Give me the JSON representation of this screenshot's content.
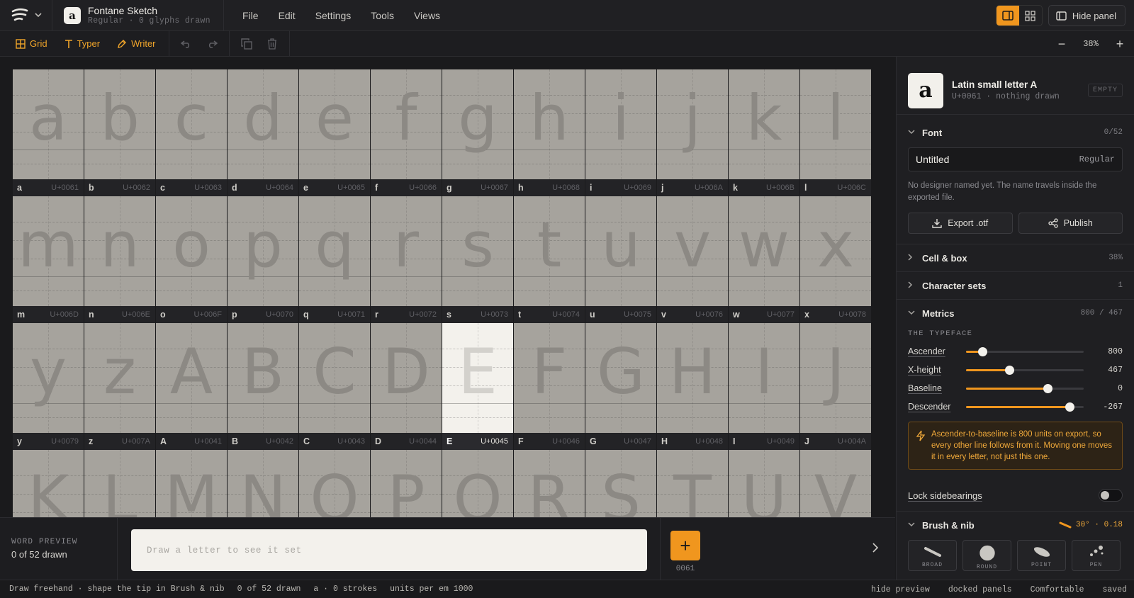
{
  "app": {
    "name": "Fontane Sketch",
    "doc_icon_glyph": "a",
    "subtitle": "Regular · 0 glyphs drawn"
  },
  "menu": [
    "File",
    "Edit",
    "Settings",
    "Tools",
    "Views"
  ],
  "top_right": {
    "hide_panel_label": "Hide panel"
  },
  "toolbar": {
    "grid": "Grid",
    "typer": "Typer",
    "writer": "Writer"
  },
  "zoom": {
    "value": "38%",
    "minus": "−",
    "plus": "+"
  },
  "glyphs": [
    {
      "char": "a",
      "code": "U+0061"
    },
    {
      "char": "b",
      "code": "U+0062"
    },
    {
      "char": "c",
      "code": "U+0063"
    },
    {
      "char": "d",
      "code": "U+0064"
    },
    {
      "char": "e",
      "code": "U+0065"
    },
    {
      "char": "f",
      "code": "U+0066"
    },
    {
      "char": "g",
      "code": "U+0067"
    },
    {
      "char": "h",
      "code": "U+0068"
    },
    {
      "char": "i",
      "code": "U+0069"
    },
    {
      "char": "j",
      "code": "U+006A"
    },
    {
      "char": "k",
      "code": "U+006B"
    },
    {
      "char": "l",
      "code": "U+006C"
    },
    {
      "char": "m",
      "code": "U+006D"
    },
    {
      "char": "n",
      "code": "U+006E"
    },
    {
      "char": "o",
      "code": "U+006F"
    },
    {
      "char": "p",
      "code": "U+0070"
    },
    {
      "char": "q",
      "code": "U+0071"
    },
    {
      "char": "r",
      "code": "U+0072"
    },
    {
      "char": "s",
      "code": "U+0073"
    },
    {
      "char": "t",
      "code": "U+0074"
    },
    {
      "char": "u",
      "code": "U+0075"
    },
    {
      "char": "v",
      "code": "U+0076"
    },
    {
      "char": "w",
      "code": "U+0077"
    },
    {
      "char": "x",
      "code": "U+0078"
    },
    {
      "char": "y",
      "code": "U+0079"
    },
    {
      "char": "z",
      "code": "U+007A"
    },
    {
      "char": "A",
      "code": "U+0041"
    },
    {
      "char": "B",
      "code": "U+0042"
    },
    {
      "char": "C",
      "code": "U+0043"
    },
    {
      "char": "D",
      "code": "U+0044"
    },
    {
      "char": "E",
      "code": "U+0045"
    },
    {
      "char": "F",
      "code": "U+0046"
    },
    {
      "char": "G",
      "code": "U+0047"
    },
    {
      "char": "H",
      "code": "U+0048"
    },
    {
      "char": "I",
      "code": "U+0049"
    },
    {
      "char": "J",
      "code": "U+004A"
    },
    {
      "char": "K",
      "code": ""
    },
    {
      "char": "L",
      "code": ""
    },
    {
      "char": "M",
      "code": ""
    },
    {
      "char": "N",
      "code": ""
    },
    {
      "char": "O",
      "code": ""
    },
    {
      "char": "P",
      "code": ""
    },
    {
      "char": "Q",
      "code": ""
    },
    {
      "char": "R",
      "code": ""
    },
    {
      "char": "S",
      "code": ""
    },
    {
      "char": "T",
      "code": ""
    },
    {
      "char": "U",
      "code": ""
    },
    {
      "char": "V",
      "code": ""
    }
  ],
  "selected_glyph": "E",
  "preview": {
    "title": "WORD PREVIEW",
    "count": "0 of 52 drawn",
    "placeholder": "Draw a letter to see it set",
    "add_label": "+",
    "code": "0061"
  },
  "panel": {
    "glyph": "a",
    "name": "Latin small letter A",
    "sub": "U+0061 · nothing drawn",
    "badge": "EMPTY",
    "font": {
      "title": "Font",
      "count": "0/52",
      "name": "Untitled",
      "style": "Regular",
      "note": "No designer named yet. The name travels inside the exported file.",
      "export_label": "Export .otf",
      "publish_label": "Publish"
    },
    "cell_box": {
      "title": "Cell & box",
      "value": "38%"
    },
    "charsets": {
      "title": "Character sets",
      "value": "1"
    },
    "metrics": {
      "title": "Metrics",
      "value": "800 / 467",
      "subhead": "THE TYPEFACE",
      "sliders": [
        {
          "label": "Ascender",
          "value": "800",
          "level": 0.14
        },
        {
          "label": "X-height",
          "value": "467",
          "level": 0.37
        },
        {
          "label": "Baseline",
          "value": "0",
          "level": 0.69
        },
        {
          "label": "Descender",
          "value": "-267",
          "level": 0.88
        }
      ],
      "warning": "Ascender-to-baseline is 800 units on export, so every other line follows from it. Moving one moves it in every letter, not just this one."
    },
    "lock": {
      "label": "Lock sidebearings"
    },
    "brush": {
      "title": "Brush & nib",
      "value": "30° · 0.18",
      "nibs": [
        "BROAD",
        "ROUND",
        "POINT",
        "PEN"
      ]
    }
  },
  "status": {
    "hint": "Draw freehand · shape the tip in Brush & nib",
    "drawn": "0 of 52 drawn",
    "current": "a · 0 strokes",
    "upm": "units per em 1000",
    "hide_preview": "hide preview",
    "docked": "docked panels",
    "density": "Comfortable",
    "saved": "saved"
  },
  "colors": {
    "accent": "#f0961e",
    "cell": "#a6a39d",
    "selected_cell": "#f3f1ec",
    "warning_text": "#f0a93a"
  }
}
